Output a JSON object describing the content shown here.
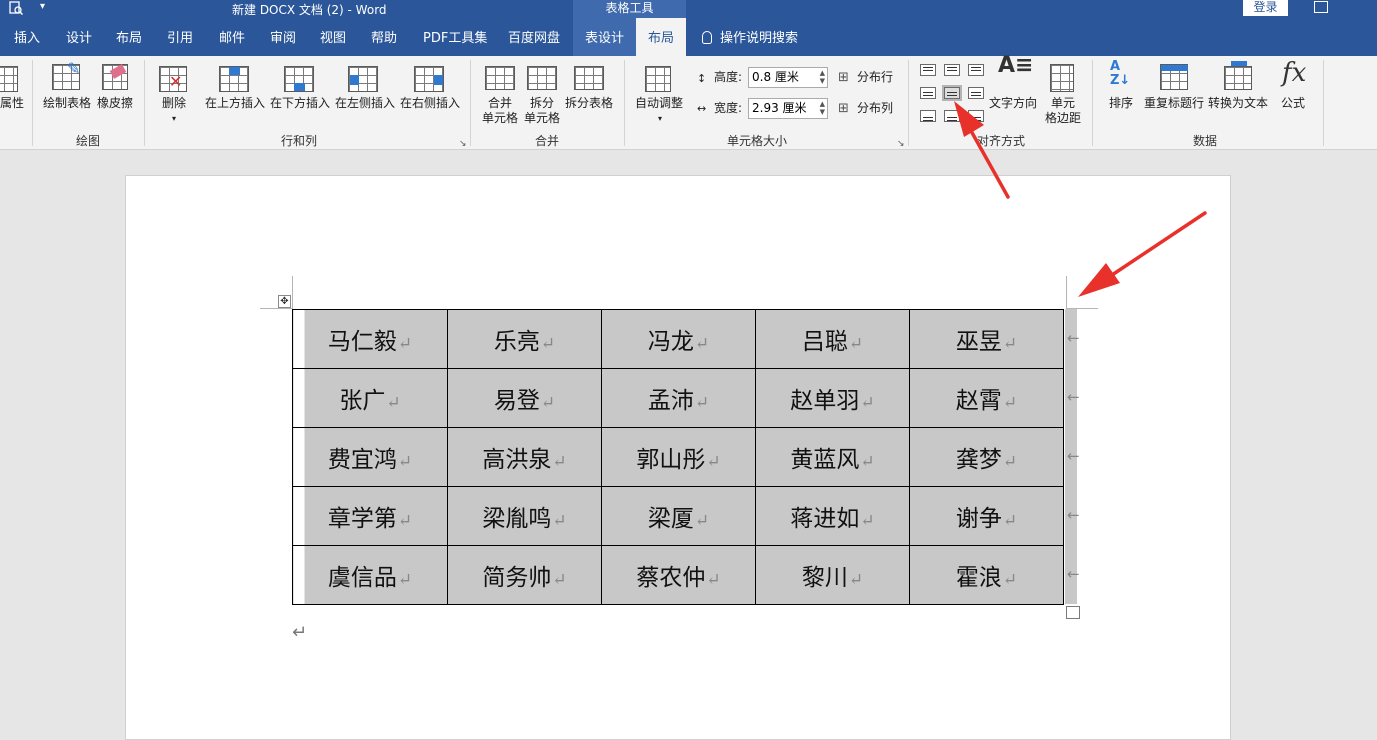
{
  "titlebar": {
    "title": "新建 DOCX 文档 (2)  -  Word",
    "context_label": "表格工具",
    "login": "登录"
  },
  "tabs": [
    {
      "label": "插入"
    },
    {
      "label": "设计"
    },
    {
      "label": "布局"
    },
    {
      "label": "引用"
    },
    {
      "label": "邮件"
    },
    {
      "label": "审阅"
    },
    {
      "label": "视图"
    },
    {
      "label": "帮助"
    },
    {
      "label": "PDF工具集"
    },
    {
      "label": "百度网盘"
    },
    {
      "label": "表设计"
    },
    {
      "label": "布局"
    },
    {
      "label": "操作说明搜索"
    }
  ],
  "ribbon": {
    "properties_label": "属性",
    "draw_table": "绘制表格",
    "eraser": "橡皮擦",
    "group_draw": "绘图",
    "delete": "删除",
    "insert_above": "在上方插入",
    "insert_below": "在下方插入",
    "insert_left": "在左侧插入",
    "insert_right": "在右侧插入",
    "group_rows_cols": "行和列",
    "merge_cells_1": "合并",
    "merge_cells_2": "单元格",
    "split_cells_1": "拆分",
    "split_cells_2": "单元格",
    "split_table": "拆分表格",
    "group_merge": "合并",
    "autofit": "自动调整",
    "height_label": "高度:",
    "height_value": "0.8 厘米",
    "width_label": "宽度:",
    "width_value": "2.93 厘米",
    "distribute_rows": "分布行",
    "distribute_cols": "分布列",
    "group_cell_size": "单元格大小",
    "text_direction": "文字方向",
    "cell_margins_1": "单元",
    "cell_margins_2": "格边距",
    "group_alignment": "对齐方式",
    "sort": "排序",
    "repeat_header": "重复标题行",
    "convert_text": "转换为文本",
    "formula": "公式",
    "formula_icon": "fx",
    "group_data": "数据"
  },
  "document": {
    "table": [
      [
        "马仁毅",
        "乐亮",
        "冯龙",
        "吕聪",
        "巫昱"
      ],
      [
        "张广",
        "易登",
        "孟沛",
        "赵单羽",
        "赵霄"
      ],
      [
        "费宜鸿",
        "高洪泉",
        "郭山彤",
        "黄蓝风",
        "龚梦"
      ],
      [
        "章学第",
        "梁胤鸣",
        "梁厦",
        "蒋进如",
        "谢争"
      ],
      [
        "虞信品",
        "简务帅",
        "蔡农仲",
        "黎川",
        "霍浪"
      ]
    ],
    "paragraph_mark": "↵"
  },
  "colors": {
    "word_blue": "#2b579a",
    "cell_shading": "#c8c8c8",
    "annotation_arrow": "#e8312b"
  }
}
